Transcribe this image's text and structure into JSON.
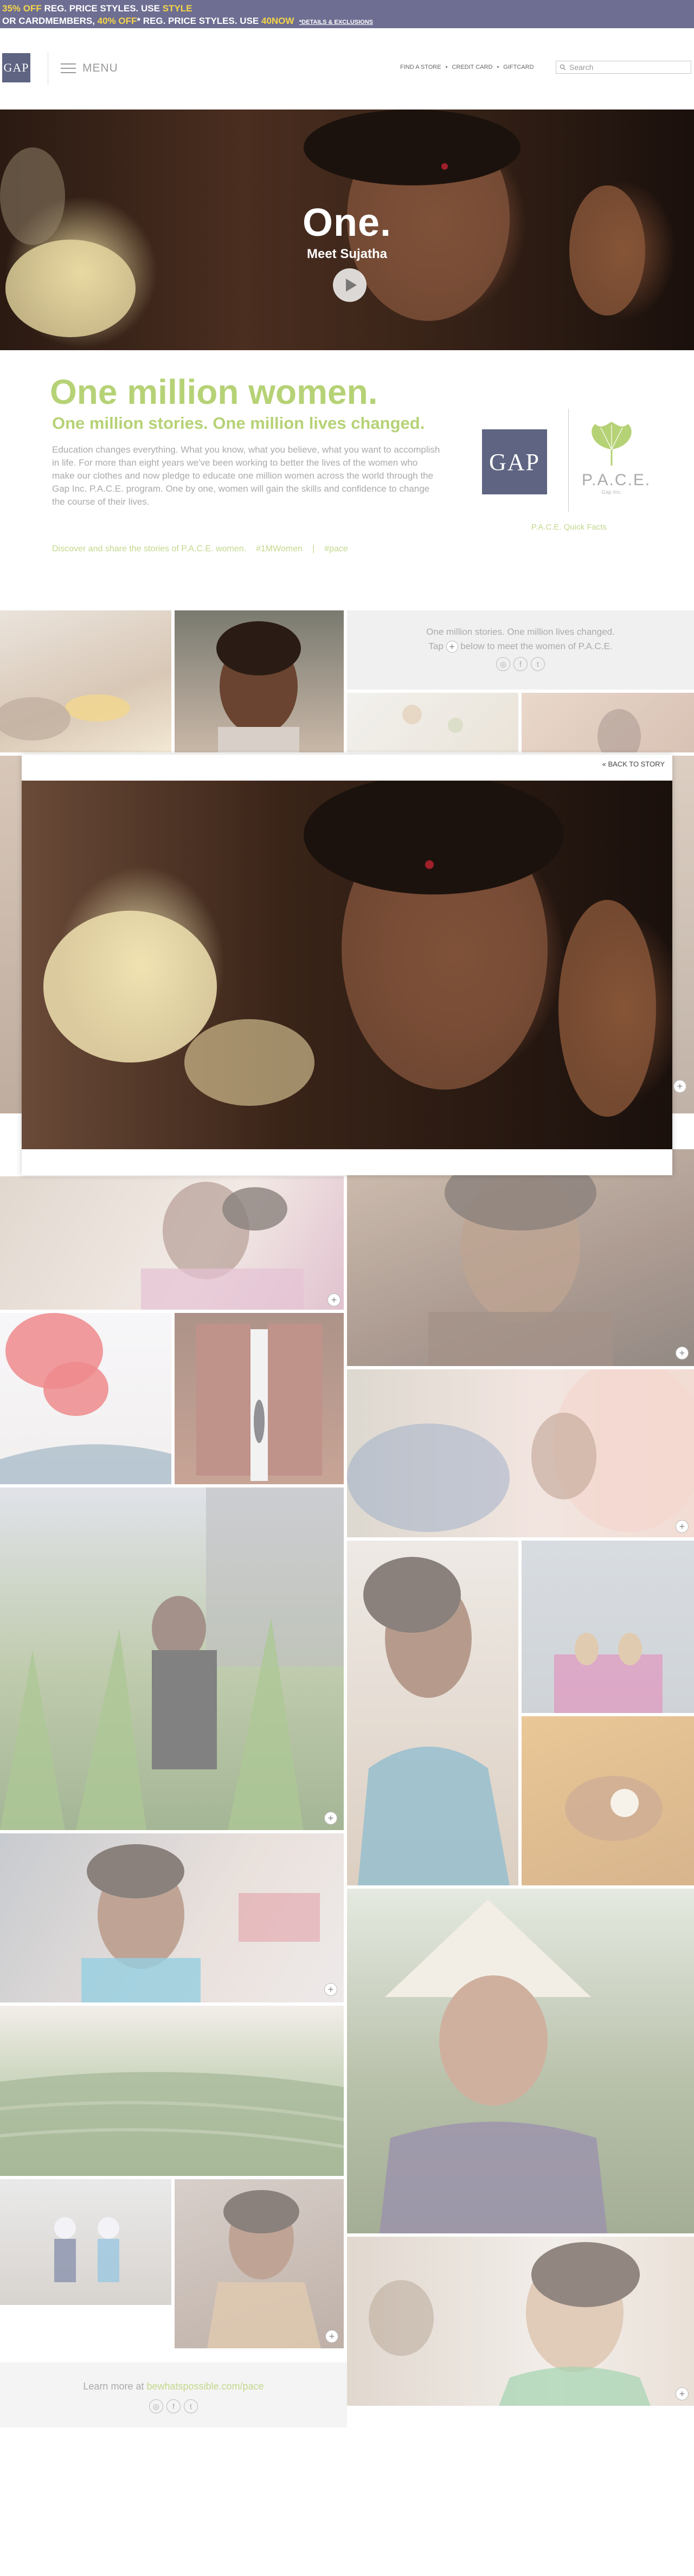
{
  "promo": {
    "line1_prefix": "35% OFF",
    "line1_mid": " REG. PRICE STYLES. USE ",
    "line1_code": "STYLE",
    "line2_prefix": "OR CARDMEMBERS, ",
    "line2_pct": "40% OFF",
    "line2_mid": "* REG. PRICE STYLES. USE ",
    "line2_code": "40NOW",
    "details": "*DETAILS & EXCLUSIONS"
  },
  "header": {
    "logo": "GAP",
    "menu_label": "MENU",
    "utility": [
      "FIND A STORE",
      "CREDIT CARD",
      "GIFTCARD"
    ],
    "utility_sep": "•",
    "search_placeholder": "Search"
  },
  "hero": {
    "title": "One.",
    "subtitle": "Meet Sujatha"
  },
  "intro": {
    "headline": "One million women.",
    "subheadline": "One million stories. One million lives changed.",
    "body": "Education changes everything. What you know, what you believe, what you want to accomplish in life. For more than eight years we've been working to better the lives of the women who make our clothes and now pledge to educate one million women across the world through the Gap Inc. P.A.C.E. program. One by one, women will gain the skills and confidence to change the course of their lives.",
    "discover": "Discover and share the stories of P.A.C.E. women.",
    "hashtag1": "#1MWomen",
    "divider": "|",
    "hashtag2": "#pace",
    "brand_logo": "GAP",
    "pace_name": "P.A.C.E.",
    "pace_tag": "Gap Inc.",
    "quick_facts": "P.A.C.E. Quick Facts"
  },
  "gallery_info": {
    "line1": "One million stories. One million lives changed.",
    "line2_pre": "Tap",
    "line2_post": "below to meet the women of P.A.C.E."
  },
  "overlay": {
    "back": "« BACK TO STORY"
  },
  "social_icons": [
    "instagram-icon",
    "facebook-icon",
    "twitter-icon"
  ],
  "learn": {
    "prefix": "Learn more at ",
    "link": "bewhatspossible.com/pace"
  }
}
